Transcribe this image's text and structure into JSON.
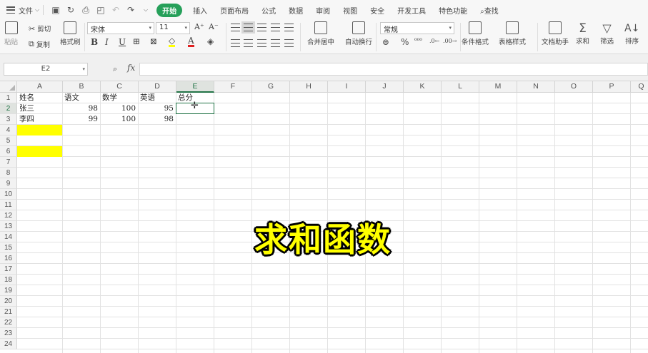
{
  "menu": {
    "file": "文件",
    "tabs": [
      "开始",
      "插入",
      "页面布局",
      "公式",
      "数据",
      "审阅",
      "视图",
      "安全",
      "开发工具",
      "特色功能"
    ],
    "active_tab": "开始",
    "search": "查找"
  },
  "ribbon": {
    "paste": "粘贴",
    "cut": "剪切",
    "copy": "复制",
    "format_painter": "格式刷",
    "font_name": "宋体",
    "font_size": "11",
    "bold": "B",
    "italic": "I",
    "underline": "U",
    "font_color": "A",
    "merge_center": "合并居中",
    "wrap_text": "自动换行",
    "number_format": "常规",
    "percent": "%",
    "cond_format": "条件格式",
    "table_style": "表格样式",
    "doc_helper": "文档助手",
    "sum": "求和",
    "filter": "筛选",
    "sort": "排序"
  },
  "formula_bar": {
    "name_box": "E2",
    "fx": "fx",
    "formula": ""
  },
  "sheet": {
    "columns": [
      "A",
      "B",
      "C",
      "D",
      "E",
      "F",
      "G",
      "H",
      "I",
      "J",
      "K",
      "L",
      "M",
      "N",
      "O",
      "P",
      "Q"
    ],
    "selected_column": "E",
    "rows": [
      "1",
      "2",
      "3",
      "4",
      "5",
      "6",
      "7",
      "8",
      "9",
      "10",
      "11",
      "12",
      "13",
      "14",
      "15",
      "16",
      "17",
      "18",
      "19",
      "20",
      "21",
      "22",
      "23",
      "24"
    ],
    "selected_row": "2",
    "headers": [
      "姓名",
      "语文",
      "数学",
      "英语",
      "总分"
    ],
    "records": [
      {
        "name": "张三",
        "chinese": "98",
        "math": "100",
        "english": "95"
      },
      {
        "name": "李四",
        "chinese": "99",
        "math": "100",
        "english": "98"
      }
    ],
    "highlight_color": "#ffff00",
    "accent_color": "#217346"
  },
  "overlay_title": "求和函数"
}
